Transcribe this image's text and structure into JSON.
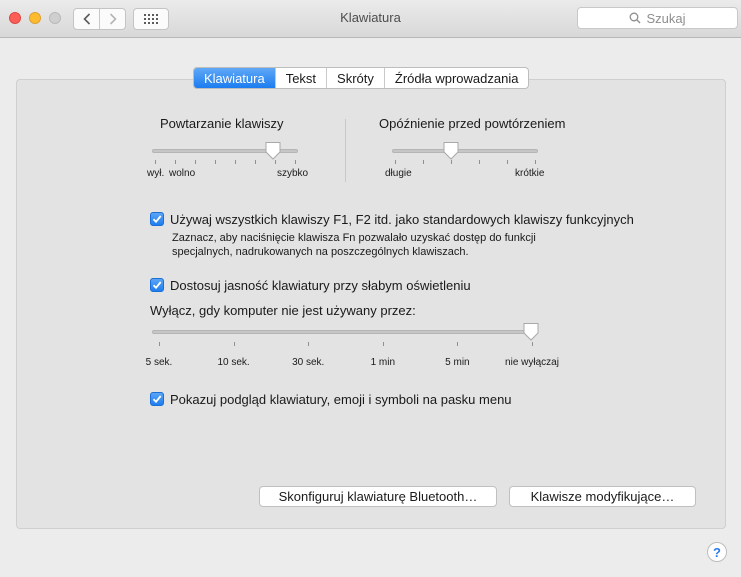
{
  "window": {
    "title": "Klawiatura"
  },
  "toolbar": {
    "search_placeholder": "Szukaj"
  },
  "tabs": [
    {
      "label": "Klawiatura",
      "active": true
    },
    {
      "label": "Tekst",
      "active": false
    },
    {
      "label": "Skróty",
      "active": false
    },
    {
      "label": "Źródła wprowadzania",
      "active": false
    }
  ],
  "key_repeat": {
    "label": "Powtarzanie klawiszy",
    "min_label": "wył.",
    "slow_label": "wolno",
    "fast_label": "szybko",
    "value_fraction": 0.84
  },
  "repeat_delay": {
    "label": "Opóźnienie przed powtórzeniem",
    "min_label": "długie",
    "max_label": "krótkie",
    "value_fraction": 0.4
  },
  "fn_keys": {
    "checked": true,
    "label": "Używaj wszystkich klawiszy F1, F2 itd. jako standardowych klawiszy funkcyjnych",
    "description_line1": "Zaznacz, aby naciśnięcie klawisza Fn pozwalało uzyskać dostęp do funkcji",
    "description_line2": "specjalnych, nadrukowanych na poszczególnych klawiszach."
  },
  "backlight": {
    "checked": true,
    "label": "Dostosuj jasność klawiatury przy słabym oświetleniu",
    "timeout_label": "Wyłącz, gdy komputer nie jest używany przez:",
    "ticks": [
      "5 sek.",
      "10 sek.",
      "30 sek.",
      "1 min",
      "5 min",
      "nie wyłączaj"
    ],
    "value_fraction": 1.0
  },
  "menu_bar": {
    "checked": true,
    "label": "Pokazuj podgląd klawiatury, emoji i symboli na pasku menu"
  },
  "buttons": {
    "bluetooth": "Skonfiguruj klawiaturę Bluetooth…",
    "modifiers": "Klawisze modyfikujące…"
  },
  "help": {
    "label": "?"
  }
}
